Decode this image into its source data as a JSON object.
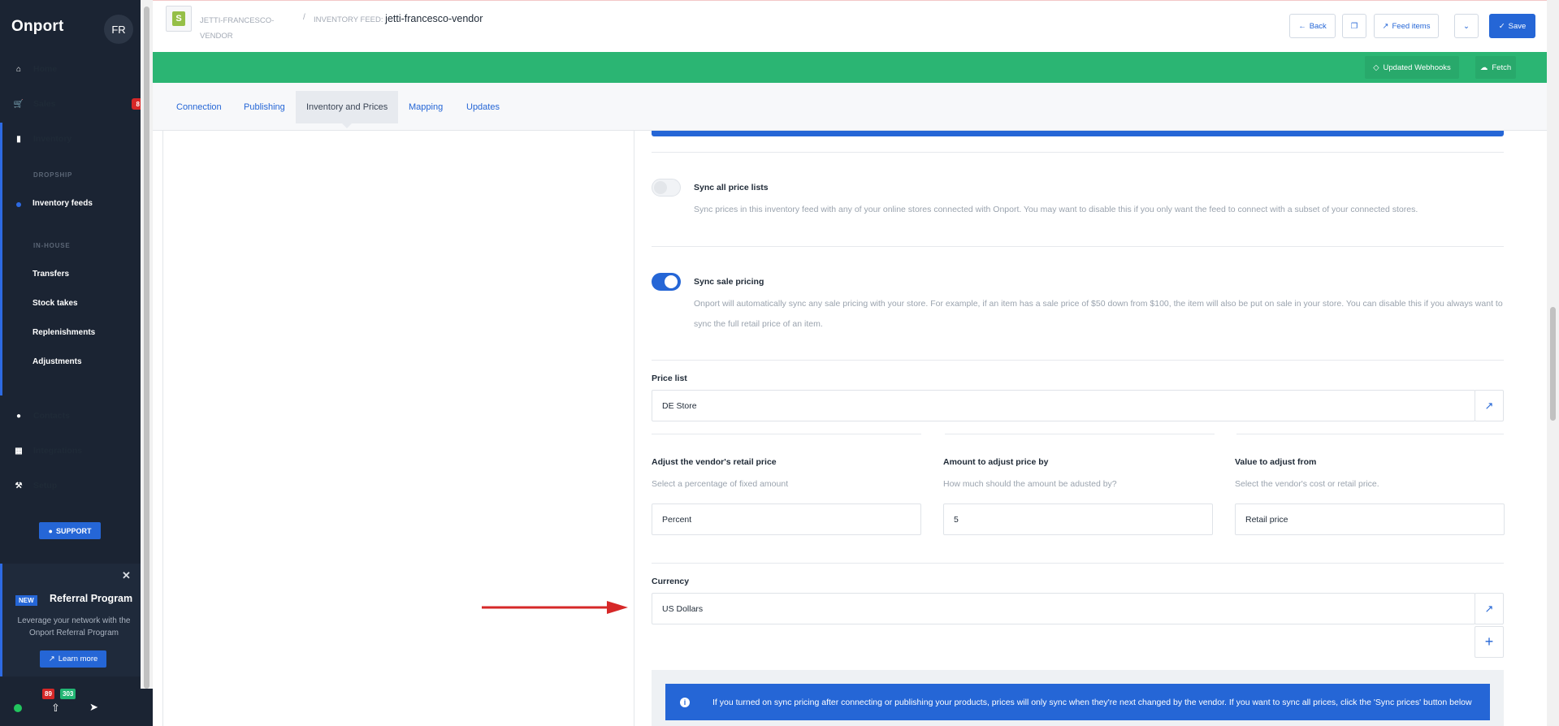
{
  "app": {
    "name": "Onport",
    "user_initials": "FR"
  },
  "sidebar": {
    "items": [
      {
        "label": "Home",
        "icon": "home-icon"
      },
      {
        "label": "Sales",
        "icon": "cart-icon",
        "badge": "8"
      },
      {
        "label": "Inventory",
        "icon": "bookmark-icon"
      },
      {
        "label": "Contacts",
        "icon": "person-icon"
      },
      {
        "label": "Integrations",
        "icon": "grid-icon"
      },
      {
        "label": "Setup",
        "icon": "wrench-icon"
      }
    ],
    "sections": {
      "dropship": "DROPSHIP",
      "inhouse": "IN-HOUSE"
    },
    "sub_items": {
      "inventory_feeds": "Inventory feeds",
      "transfers": "Transfers",
      "stock_takes": "Stock takes",
      "replenishments": "Replenishments",
      "adjustments": "Adjustments"
    },
    "support_label": "SUPPORT",
    "referral": {
      "tag": "NEW",
      "title": "Referral Program",
      "desc": "Leverage your network with the Onport Referral Program",
      "button": "Learn more"
    },
    "bottom": {
      "badge_red": "89",
      "badge_green": "303"
    }
  },
  "header": {
    "crumb1": "JETTI-FRANCESCO-VENDOR",
    "crumb_sep": "/",
    "crumb2_prefix": "INVENTORY FEED:",
    "crumb2_value": "jetti-francesco-vendor",
    "buttons": {
      "back": "Back",
      "feed_items": "Feed items",
      "save": "Save"
    }
  },
  "greenbar": {
    "updated_webhooks": "Updated Webhooks",
    "fetch": "Fetch"
  },
  "tabs": [
    {
      "label": "Connection"
    },
    {
      "label": "Publishing"
    },
    {
      "label": "Inventory and Prices",
      "active": true
    },
    {
      "label": "Mapping"
    },
    {
      "label": "Updates"
    }
  ],
  "settings": {
    "sync_all_price_lists": {
      "label": "Sync all price lists",
      "help": "Sync prices in this inventory feed with any of your online stores connected with Onport. You may want to disable this if you only want the feed to connect with a subset of your connected stores.",
      "enabled": false
    },
    "sync_sale_pricing": {
      "label": "Sync sale pricing",
      "help_line1": "Onport will automatically sync any sale pricing with your store. For example, if an item has a sale price of $50 down from $100, the item will also be put on sale in your store. You can disable this if you always want to",
      "help_line2": "sync the full retail price of an item.",
      "enabled": true
    },
    "price_list": {
      "label": "Price list",
      "value": "DE Store"
    },
    "adjust_retail": {
      "label": "Adjust the vendor's retail price",
      "help": "Select a percentage of fixed amount",
      "value": "Percent"
    },
    "amount": {
      "label": "Amount to adjust price by",
      "help": "How much should the amount be adusted by?",
      "value": "5"
    },
    "value_from": {
      "label": "Value to adjust from",
      "help": "Select the vendor's cost or retail price.",
      "value": "Retail price"
    },
    "currency": {
      "label": "Currency",
      "value": "US Dollars"
    }
  },
  "info_message": "If you turned on sync pricing after connecting or publishing your products, prices will only sync when they're next changed by the vendor. If you want to sync all prices, click the 'Sync prices' button below",
  "colors": {
    "primary": "#2566d6",
    "green": "#2bb573",
    "sidebar": "#1b2433",
    "arrow": "#d62828"
  }
}
